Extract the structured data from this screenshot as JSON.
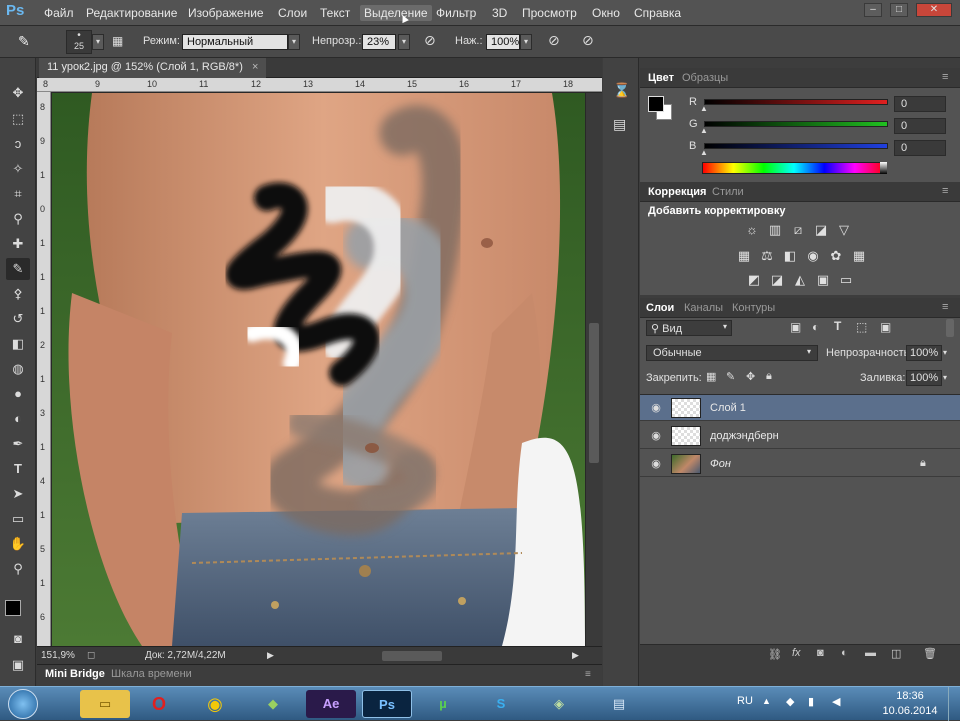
{
  "app": {
    "logo": "Ps",
    "menu": [
      "Файл",
      "Редактирование",
      "Изображение",
      "Слои",
      "Текст",
      "Выделение",
      "Фильтр",
      "3D",
      "Просмотр",
      "Окно",
      "Справка"
    ],
    "active_menu_index": 5
  },
  "options_bar": {
    "brush_size": "25",
    "mode_label": "Режим:",
    "mode_value": "Нормальный",
    "opacity_label": "Непрозр.:",
    "opacity_value": "23%",
    "flow_label": "Наж.:",
    "flow_value": "100%"
  },
  "document": {
    "tab_title": "11 урок2.jpg @ 152% (Слой 1, RGB/8*)",
    "tab_close": "×",
    "ruler_top": [
      "8",
      "9",
      "10",
      "11",
      "12",
      "13",
      "14",
      "15",
      "16",
      "17",
      "18"
    ],
    "ruler_left": [
      "8",
      "9",
      "1",
      "0",
      "1",
      "1",
      "1",
      "2",
      "1",
      "3",
      "1",
      "4",
      "1",
      "5",
      "1",
      "6"
    ],
    "zoom": "151,9%",
    "doc_info": "Док: 2,72M/4,22M"
  },
  "bottom_tabs": [
    "Mini Bridge",
    "Шкала времени"
  ],
  "color_panel": {
    "tabs": [
      "Цвет",
      "Образцы"
    ],
    "channels": [
      {
        "label": "R",
        "value": "0",
        "color": "#e02020"
      },
      {
        "label": "G",
        "value": "0",
        "color": "#20c020"
      },
      {
        "label": "B",
        "value": "0",
        "color": "#2040e0"
      }
    ]
  },
  "adjust_panel": {
    "tabs": [
      "Коррекция",
      "Стили"
    ],
    "title": "Добавить корректировку",
    "row1": [
      "brightness-icon",
      "levels-icon",
      "curves-icon",
      "exposure-icon",
      "vibrance-triangle-icon"
    ],
    "row2": [
      "hue-saturation-icon",
      "color-balance-icon",
      "black-white-icon",
      "photo-filter-icon",
      "channel-mixer-icon",
      "color-lookup-icon"
    ],
    "row3": [
      "invert-icon",
      "posterize-icon",
      "threshold-icon",
      "selective-color-icon",
      "gradient-map-icon"
    ]
  },
  "layers_panel": {
    "tabs": [
      "Слои",
      "Каналы",
      "Контуры"
    ],
    "filter_kind": "Вид",
    "blend_mode": "Обычные",
    "opacity_label": "Непрозрачность:",
    "opacity_value": "100%",
    "lock_label": "Закрепить:",
    "fill_label": "Заливка:",
    "fill_value": "100%",
    "layers": [
      {
        "name": "Слой 1",
        "selected": true,
        "locked": false
      },
      {
        "name": "доджэндберн",
        "selected": false,
        "locked": false
      },
      {
        "name": "Фон",
        "selected": false,
        "locked": true
      }
    ]
  },
  "taskbar": {
    "lang": "RU",
    "time": "18:36",
    "date": "10.06.2014"
  }
}
